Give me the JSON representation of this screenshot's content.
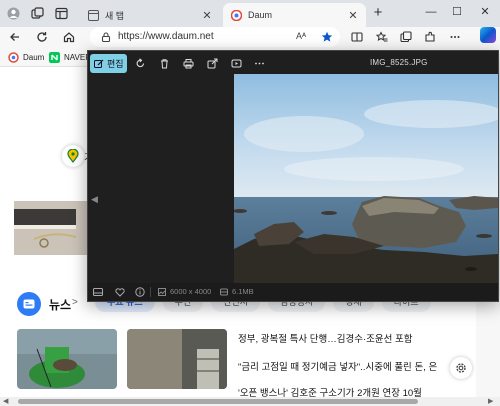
{
  "browser": {
    "tabs": [
      {
        "title": "새 탭",
        "active": false
      },
      {
        "title": "Daum",
        "active": true
      }
    ],
    "url": "https://www.daum.net",
    "bookmarks": [
      "Daum",
      "NAVER"
    ],
    "reader_label": "Aᴬ"
  },
  "viewer": {
    "edit_label": "편집",
    "filename": "IMG_8525.JPG",
    "resolution": "6000 x 4000",
    "filesize": "6.1MB"
  },
  "page": {
    "weather_partial": "기",
    "news_title": "뉴스",
    "news_chevron": ">",
    "news_tabs": [
      "주요 뉴스",
      "우연",
      "산언시",
      "임성성시",
      "경세",
      "라이프"
    ],
    "headlines": [
      "정부, 광복절 특사 단행…김경수·조윤선 포함",
      "\"금리 고점일 때 정기예금 넣자\"..시중에 풀린 돈, 은",
      "'오픈 뱅스나' 김호준 구소기가 2개원 연장 10월"
    ]
  },
  "colors": {
    "accent": "#0b57d0",
    "edit_button": "#7fd0e6",
    "news_logo": "#2e7bf6",
    "viewer_bg": "#1f1f1f"
  }
}
